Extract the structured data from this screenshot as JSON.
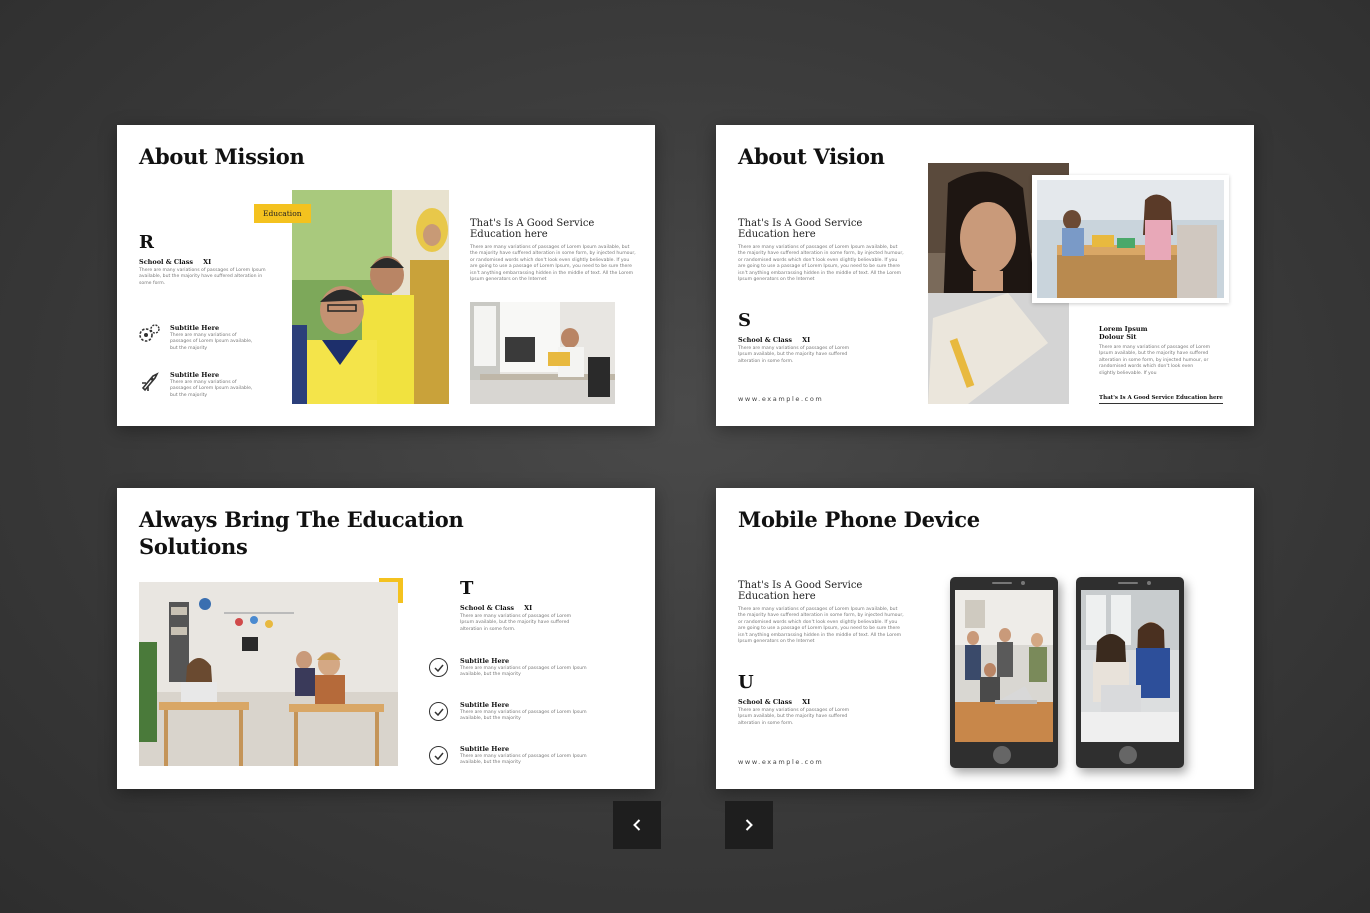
{
  "colors": {
    "accent": "#f4c21f",
    "background": "#3b3b3b",
    "slide": "#ffffff",
    "nav_button": "#1e1e1e"
  },
  "nav": {
    "prev_icon": "chevron-left-icon",
    "next_icon": "chevron-right-icon"
  },
  "slides": [
    {
      "title": "About Mission",
      "badge": "Education",
      "letter": "R",
      "school_label": "School & Class",
      "class_value": "XI",
      "body": "There are many variations of passages of Lorem Ipsum available, but the majority have suffered alteration in some form.",
      "heading": "That's Is A Good Service Education here",
      "heading_body": "There are many variations of passages of Lorem Ipsum available, but the majority have suffered alteration in some form, by injected humour, or randomised words which don't look even slightly believable. If you are going to use a passage of Lorem Ipsum, you need to be sure there isn't anything embarrassing hidden in the middle of text. All the Lorem Ipsum generators on the Internet",
      "items": [
        {
          "icon": "gears-icon",
          "subtitle": "Subtitle Here",
          "text": "There are many variations of passages of Lorem Ipsum available, but the majority"
        },
        {
          "icon": "rocket-icon",
          "subtitle": "Subtitle Here",
          "text": "There are many variations of passages of Lorem Ipsum available, but the majority"
        }
      ]
    },
    {
      "title": "About Vision",
      "heading": "That's Is A Good Service Education here",
      "heading_body": "There are many variations of passages of Lorem Ipsum available, but the majority have suffered alteration in some form, by injected humour, or randomised words which don't look even slightly believable. If you are going to use a passage of Lorem Ipsum, you need to be sure there isn't anything embarrassing hidden in the middle of text. All the Lorem Ipsum generators on the Internet",
      "letter": "S",
      "school_label": "School & Class",
      "class_value": "XI",
      "body": "There are many variations of passages of Lorem Ipsum available, but the majority have suffered alteration in some form.",
      "url": "www.example.com",
      "side_heading": "Lorem Ipsum Dolour Sit",
      "side_body": "There are many variations of passages of Lorem Ipsum available, but the majority have suffered alteration in some form, by injected humour, or randomised words which don't look even slightly believable. If you",
      "side_link": "That's Is A Good Service Education here"
    },
    {
      "title": "Always Bring The Education Solutions",
      "letter": "T",
      "school_label": "School & Class",
      "class_value": "XI",
      "body": "There are many variations of passages of Lorem Ipsum available, but the majority have suffered alteration in some form.",
      "items": [
        {
          "subtitle": "Subtitle Here",
          "text": "There are many variations of passages of Lorem Ipsum available, but the majority"
        },
        {
          "subtitle": "Subtitle Here",
          "text": "There are many variations of passages of Lorem Ipsum available, but the majority"
        },
        {
          "subtitle": "Subtitle Here",
          "text": "There are many variations of passages of Lorem Ipsum available, but the majority"
        }
      ]
    },
    {
      "title": "Mobile Phone Device",
      "heading": "That's Is A Good Service Education here",
      "heading_body": "There are many variations of passages of Lorem Ipsum available, but the majority have suffered alteration in some form, by injected humour, or randomised words which don't look even slightly believable. If you are going to use a passage of Lorem Ipsum, you need to be sure there isn't anything embarrassing hidden in the middle of text. All the Lorem Ipsum generators on the Internet",
      "letter": "U",
      "school_label": "School & Class",
      "class_value": "XI",
      "body": "There are many variations of passages of Lorem Ipsum available, but the majority have suffered alteration in some form.",
      "url": "www.example.com"
    }
  ]
}
